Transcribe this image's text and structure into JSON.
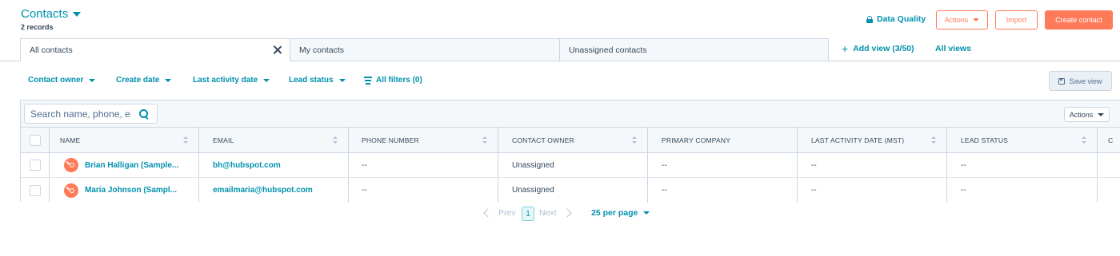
{
  "header": {
    "title": "Contacts",
    "records": "2 records",
    "data_quality": "Data Quality",
    "actions_label": "Actions",
    "import_label": "Import",
    "create_label": "Create contact"
  },
  "tabs": [
    {
      "label": "All contacts",
      "active": true
    },
    {
      "label": "My contacts",
      "active": false
    },
    {
      "label": "Unassigned contacts",
      "active": false
    }
  ],
  "views": {
    "add_view": "Add view (3/50)",
    "all_views": "All views"
  },
  "filters": {
    "contact_owner": "Contact owner",
    "create_date": "Create date",
    "last_activity_date": "Last activity date",
    "lead_status": "Lead status",
    "all_filters": "All filters (0)"
  },
  "save_view": "Save view",
  "table": {
    "search_placeholder": "Search name, phone, e",
    "actions_label": "Actions",
    "columns": [
      "NAME",
      "EMAIL",
      "PHONE NUMBER",
      "CONTACT OWNER",
      "PRIMARY COMPANY",
      "LAST ACTIVITY DATE (MST)",
      "LEAD STATUS",
      "C"
    ],
    "rows": [
      {
        "name": "Brian Halligan (Sample...",
        "email": "bh@hubspot.com",
        "phone": "--",
        "owner": "Unassigned",
        "company": "--",
        "last_activity": "--",
        "lead_status": "--"
      },
      {
        "name": "Maria Johnson (Sampl...",
        "email": "emailmaria@hubspot.com",
        "phone": "--",
        "owner": "Unassigned",
        "company": "--",
        "last_activity": "--",
        "lead_status": "--"
      }
    ]
  },
  "pagination": {
    "prev": "Prev",
    "current_page": "1",
    "next": "Next",
    "per_page": "25 per page"
  },
  "colors": {
    "accent": "#0091ae",
    "brand": "#ff7a59",
    "text": "#33475b",
    "border": "#cbd6e2"
  }
}
